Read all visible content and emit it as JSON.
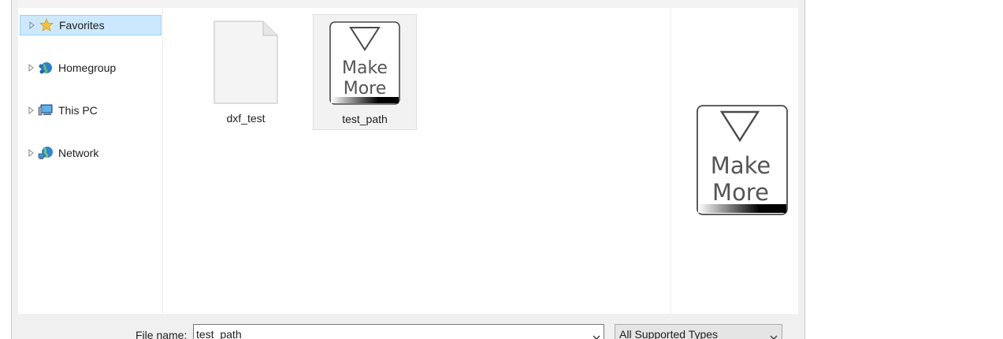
{
  "nav": {
    "items": [
      {
        "label": "Favorites",
        "icon": "star-icon",
        "selected": true
      },
      {
        "label": "Homegroup",
        "icon": "homegroup-icon",
        "selected": false
      },
      {
        "label": "This PC",
        "icon": "computer-icon",
        "selected": false
      },
      {
        "label": "Network",
        "icon": "network-icon",
        "selected": false
      }
    ]
  },
  "files": [
    {
      "name": "dxf_test",
      "icon": "blank-file-icon",
      "selected": false
    },
    {
      "name": "test_path",
      "icon": "make-more-thumbnail",
      "selected": true
    }
  ],
  "thumbnail": {
    "line1": "Make",
    "line2": "More"
  },
  "bottom": {
    "file_name_label": "File name:",
    "file_name_value": "test_path",
    "file_type": "All Supported Types"
  }
}
